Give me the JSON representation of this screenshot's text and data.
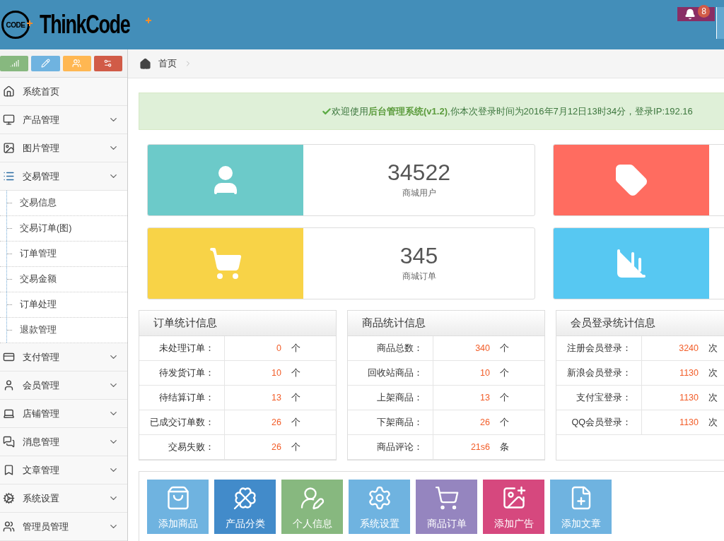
{
  "header": {
    "logo_badge": "CODE",
    "logo_text": "ThinkCode",
    "notifications": {
      "count": "8"
    }
  },
  "shortcuts": [
    {
      "color": "#87b87f"
    },
    {
      "color": "#6fb3e0"
    },
    {
      "color": "#ffb752"
    },
    {
      "color": "#d15b47"
    }
  ],
  "sidebar": {
    "items": [
      {
        "label": "系统首页",
        "kind": "link"
      },
      {
        "label": "产品管理",
        "kind": "menu"
      },
      {
        "label": "图片管理",
        "kind": "menu"
      },
      {
        "label": "交易管理",
        "kind": "menu",
        "children": [
          {
            "label": "交易信息"
          },
          {
            "label": "交易订单(图)"
          },
          {
            "label": "订单管理"
          },
          {
            "label": "交易金额"
          },
          {
            "label": "订单处理"
          },
          {
            "label": "退款管理"
          }
        ]
      },
      {
        "label": "支付管理",
        "kind": "menu"
      },
      {
        "label": "会员管理",
        "kind": "menu"
      },
      {
        "label": "店铺管理",
        "kind": "menu"
      },
      {
        "label": "消息管理",
        "kind": "menu"
      },
      {
        "label": "文章管理",
        "kind": "menu"
      },
      {
        "label": "系统设置",
        "kind": "menu"
      },
      {
        "label": "管理员管理",
        "kind": "menu"
      }
    ]
  },
  "breadcrumb": [
    "首页"
  ],
  "welcome": "欢迎使用**后台管理系统(v1.2)**,你本次登录时间为2016年7月12日13时34分，登录IP:192.16",
  "stat_cards": [
    {
      "color": "#6ccac9",
      "value": "34522",
      "label": "商城用户"
    },
    {
      "color": "#ff6c60"
    },
    {
      "color": "#f8d347",
      "value": "345",
      "label": "商城订单"
    },
    {
      "color": "#57c8f2"
    }
  ],
  "stat_tables": [
    {
      "title": "订单统计信息",
      "rows": [
        {
          "label": "未处理订单：",
          "value": "0",
          "unit": "个"
        },
        {
          "label": "待发货订单：",
          "value": "10",
          "unit": "个"
        },
        {
          "label": "待结算订单：",
          "value": "13",
          "unit": "个"
        },
        {
          "label": "已成交订单数：",
          "value": "26",
          "unit": "个"
        },
        {
          "label": "交易失败：",
          "value": "26",
          "unit": "个"
        }
      ]
    },
    {
      "title": "商品统计信息",
      "rows": [
        {
          "label": "商品总数：",
          "value": "340",
          "unit": "个"
        },
        {
          "label": "回收站商品：",
          "value": "10",
          "unit": "个"
        },
        {
          "label": "上架商品：",
          "value": "13",
          "unit": "个"
        },
        {
          "label": "下架商品：",
          "value": "26",
          "unit": "个"
        },
        {
          "label": "商品评论：",
          "value": "21s6",
          "unit": "条"
        }
      ]
    },
    {
      "title": "会员登录统计信息",
      "rows": [
        {
          "label": "注册会员登录：",
          "value": "3240",
          "unit": "次"
        },
        {
          "label": "新浪会员登录：",
          "value": "1130",
          "unit": "次"
        },
        {
          "label": "支付宝登录：",
          "value": "1130",
          "unit": "次"
        },
        {
          "label": "QQ会员登录：",
          "value": "1130",
          "unit": "次"
        }
      ]
    }
  ],
  "quick_actions": [
    {
      "label": "添加商品",
      "color": "#6fb3e0"
    },
    {
      "label": "产品分类",
      "color": "#428bca"
    },
    {
      "label": "个人信息",
      "color": "#87b87f"
    },
    {
      "label": "系统设置",
      "color": "#6fb3e0"
    },
    {
      "label": "商品订单",
      "color": "#9585bf"
    },
    {
      "label": "添加广告",
      "color": "#d6487e"
    },
    {
      "label": "添加文章",
      "color": "#6fb3e0"
    }
  ]
}
